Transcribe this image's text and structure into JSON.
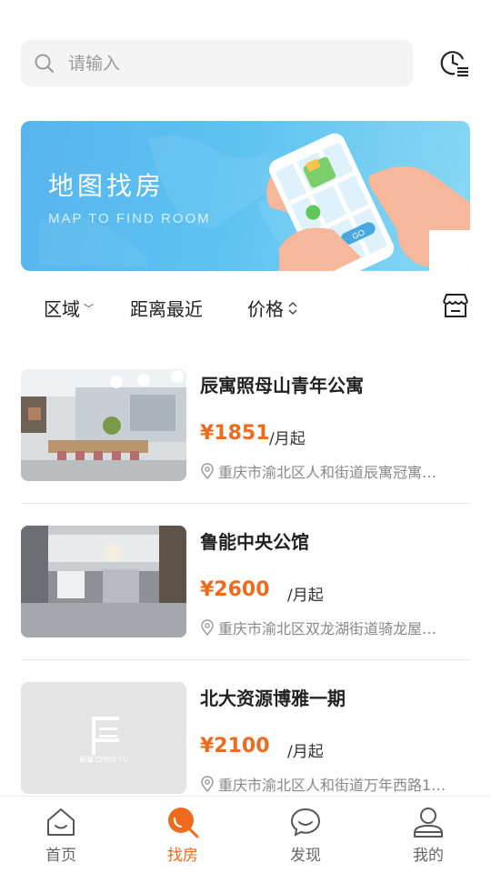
{
  "search": {
    "placeholder": "请输入"
  },
  "banner": {
    "title": "地图找房",
    "subtitle": "MAP TO FIND ROOM"
  },
  "filters": {
    "area": "区域",
    "distance": "距离最近",
    "price": "价格"
  },
  "listings": [
    {
      "name": "辰寓照母山青年公寓",
      "price": "¥1851",
      "unit": "/月起",
      "address": "重庆市渝北区人和街道辰寓冠寓…"
    },
    {
      "name": "鲁能中央公馆",
      "price": "¥2600",
      "unit": "/月起",
      "address": "重庆市渝北区双龙湖街道骑龙屋…"
    },
    {
      "name": "北大资源博雅一期",
      "price": "¥2100",
      "unit": "/月起",
      "address": "重庆市渝北区人和街道万年西路1…"
    }
  ],
  "placeholder_logo": {
    "text": "辰寓 CHEN YU"
  },
  "tabbar": {
    "home": "首页",
    "find": "找房",
    "discover": "发现",
    "mine": "我的"
  },
  "colors": {
    "accent": "#ee6a1d",
    "banner": "#5cc2f0"
  }
}
